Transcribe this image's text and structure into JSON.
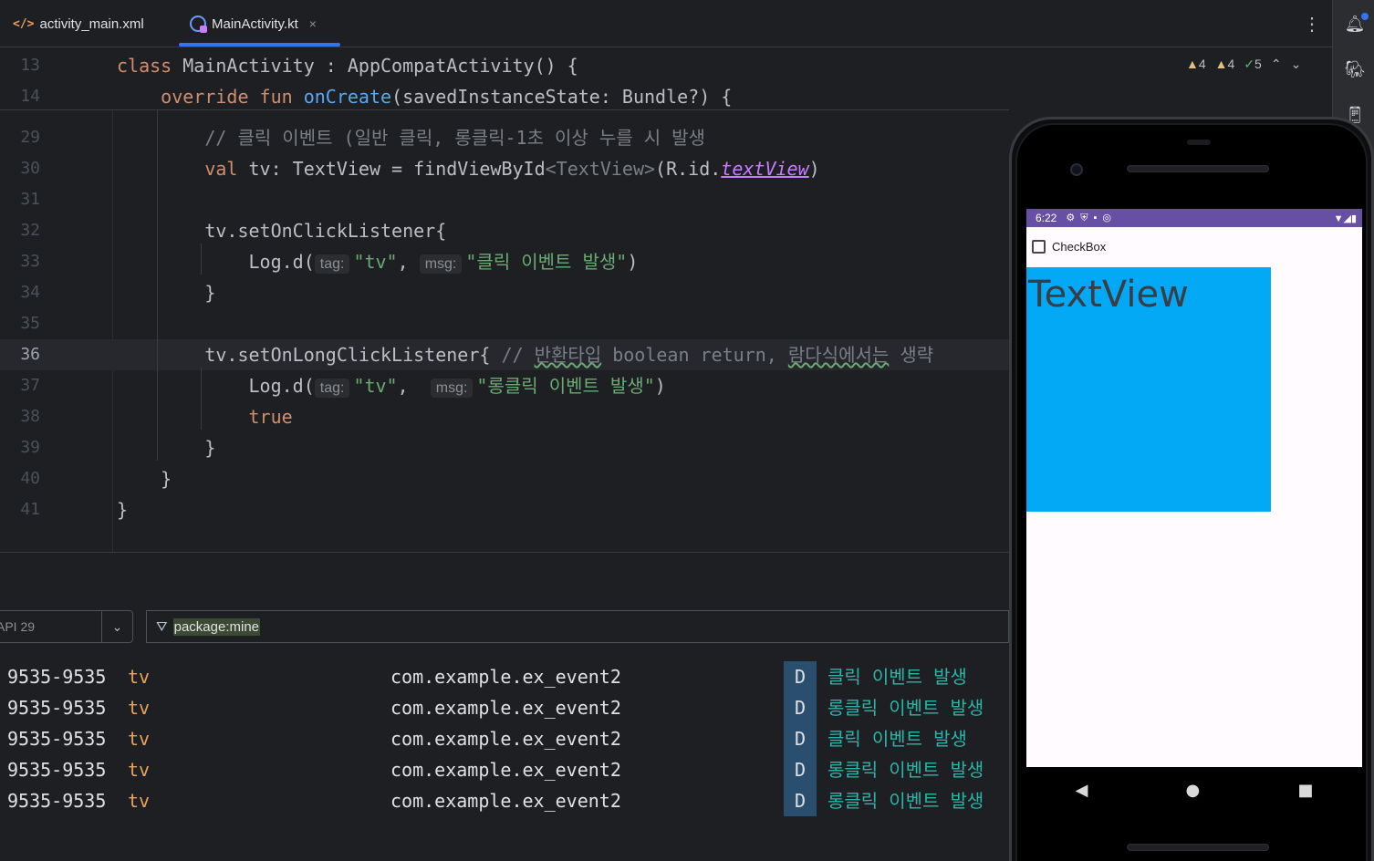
{
  "tabs": [
    {
      "label": "activity_main.xml",
      "icon": "xml-file-icon",
      "active": false
    },
    {
      "label": "MainActivity.kt",
      "icon": "kotlin-file-icon",
      "active": true
    }
  ],
  "toolbar": {
    "more_glyph": "⋮",
    "close_glyph": "×"
  },
  "inspections": {
    "warnings_a": "4",
    "warnings_b": "4",
    "ok": "5"
  },
  "editor": {
    "lines": [
      {
        "n": "13",
        "parts": [
          [
            "kw",
            "class "
          ],
          [
            "t",
            "MainActivity : AppCompatActivity() {"
          ]
        ]
      },
      {
        "n": "14",
        "parts": [
          [
            "t",
            "    "
          ],
          [
            "kw",
            "override fun "
          ],
          [
            "fn",
            "onCreate"
          ],
          [
            "t",
            "(savedInstanceState: Bundle?) {"
          ]
        ]
      },
      {
        "n": "29",
        "parts": [
          [
            "t",
            "        "
          ],
          [
            "cm",
            "// 클릭 이벤트 (일반 클릭, 롱클릭-1초 이상 누를 시 발생"
          ]
        ]
      },
      {
        "n": "30",
        "parts": [
          [
            "t",
            "        "
          ],
          [
            "kw",
            "val "
          ],
          [
            "t",
            "tv: TextView = findViewById"
          ],
          [
            "gen",
            "<TextView>"
          ],
          [
            "t",
            "(R.id."
          ],
          [
            "prop",
            "textView"
          ],
          [
            "t",
            ")"
          ]
        ]
      },
      {
        "n": "31",
        "parts": []
      },
      {
        "n": "32",
        "parts": [
          [
            "t",
            "        tv.setOnClickListener{"
          ]
        ]
      },
      {
        "n": "33",
        "parts": [
          [
            "t",
            "            Log.d("
          ],
          [
            "hint",
            "tag:"
          ],
          [
            "str",
            "\"tv\""
          ],
          [
            "t",
            ", "
          ],
          [
            "hint",
            "msg:"
          ],
          [
            "str",
            "\"클릭 이벤트 발생\""
          ],
          [
            "t",
            ")"
          ]
        ]
      },
      {
        "n": "34",
        "parts": [
          [
            "t",
            "        }"
          ]
        ]
      },
      {
        "n": "35",
        "parts": []
      },
      {
        "n": "36",
        "parts": [
          [
            "t",
            "        tv.setOnLongClickListener{ "
          ],
          [
            "cm",
            "// "
          ],
          [
            "cmsq",
            "반환타입"
          ],
          [
            "cm",
            " boolean return, "
          ],
          [
            "cmsq",
            "람다식에서는"
          ],
          [
            "cm",
            " 생략"
          ]
        ],
        "highlight": true
      },
      {
        "n": "37",
        "parts": [
          [
            "t",
            "            Log.d("
          ],
          [
            "hint",
            "tag:"
          ],
          [
            "str",
            "\"tv\""
          ],
          [
            "t",
            ",  "
          ],
          [
            "hint",
            "msg:"
          ],
          [
            "str",
            "\"롱클릭 이벤트 발생\""
          ],
          [
            "t",
            ")"
          ]
        ]
      },
      {
        "n": "38",
        "parts": [
          [
            "t",
            "            "
          ],
          [
            "kw",
            "true"
          ]
        ]
      },
      {
        "n": "39",
        "parts": [
          [
            "t",
            "        }"
          ]
        ]
      },
      {
        "n": "40",
        "parts": [
          [
            "t",
            "    }"
          ]
        ]
      },
      {
        "n": "41",
        "parts": [
          [
            "t",
            "}"
          ]
        ]
      }
    ]
  },
  "logcat": {
    "device": "API 29",
    "filter": "package:mine",
    "rows": [
      {
        "pid": "9535-9535",
        "tag": "tv",
        "package": "com.example.ex_event2",
        "level": "D",
        "message": "클릭 이벤트 발생"
      },
      {
        "pid": "9535-9535",
        "tag": "tv",
        "package": "com.example.ex_event2",
        "level": "D",
        "message": "롱클릭 이벤트 발생"
      },
      {
        "pid": "9535-9535",
        "tag": "tv",
        "package": "com.example.ex_event2",
        "level": "D",
        "message": "클릭 이벤트 발생"
      },
      {
        "pid": "9535-9535",
        "tag": "tv",
        "package": "com.example.ex_event2",
        "level": "D",
        "message": "롱클릭 이벤트 발생"
      },
      {
        "pid": "9535-9535",
        "tag": "tv",
        "package": "com.example.ex_event2",
        "level": "D",
        "message": "롱클릭 이벤트 발생"
      }
    ]
  },
  "emulator": {
    "time": "6:22",
    "checkbox_label": "CheckBox",
    "textview_text": "TextView",
    "colors": {
      "status_bar": "#6750a4",
      "textview_bg": "#03a9f4"
    }
  }
}
